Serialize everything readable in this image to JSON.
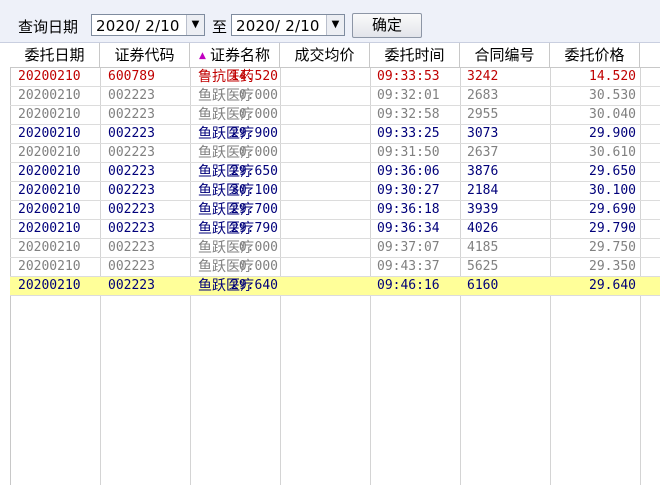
{
  "toolbar": {
    "query_label": "查询日期",
    "start_date": "2020/ 2/10",
    "to_label": "至",
    "end_date": "2020/ 2/10",
    "confirm_label": "确定",
    "dropdown_glyph": "▼"
  },
  "colors": {
    "red": "#c00000",
    "blue": "#00007a",
    "gray": "#808080",
    "highlight_bg": "#ffff99"
  },
  "table": {
    "columns": [
      "委托日期",
      "证券代码",
      "证券名称",
      "成交均价",
      "委托时间",
      "合同编号",
      "委托价格"
    ],
    "sort_indicator": "▲",
    "rows": [
      {
        "date": "20200210",
        "code": "600789",
        "name": "鲁抗医药",
        "avg_price": "14.520",
        "time": "09:33:53",
        "contract": "3242",
        "price": "14.520",
        "color": "red",
        "highlight": false
      },
      {
        "date": "20200210",
        "code": "002223",
        "name": "鱼跃医疗",
        "avg_price": "0.000",
        "time": "09:32:01",
        "contract": "2683",
        "price": "30.530",
        "color": "gray",
        "highlight": false
      },
      {
        "date": "20200210",
        "code": "002223",
        "name": "鱼跃医疗",
        "avg_price": "0.000",
        "time": "09:32:58",
        "contract": "2955",
        "price": "30.040",
        "color": "gray",
        "highlight": false
      },
      {
        "date": "20200210",
        "code": "002223",
        "name": "鱼跃医疗",
        "avg_price": "29.900",
        "time": "09:33:25",
        "contract": "3073",
        "price": "29.900",
        "color": "blue",
        "highlight": false
      },
      {
        "date": "20200210",
        "code": "002223",
        "name": "鱼跃医疗",
        "avg_price": "0.000",
        "time": "09:31:50",
        "contract": "2637",
        "price": "30.610",
        "color": "gray",
        "highlight": false
      },
      {
        "date": "20200210",
        "code": "002223",
        "name": "鱼跃医疗",
        "avg_price": "29.650",
        "time": "09:36:06",
        "contract": "3876",
        "price": "29.650",
        "color": "blue",
        "highlight": false
      },
      {
        "date": "20200210",
        "code": "002223",
        "name": "鱼跃医疗",
        "avg_price": "30.100",
        "time": "09:30:27",
        "contract": "2184",
        "price": "30.100",
        "color": "blue",
        "highlight": false
      },
      {
        "date": "20200210",
        "code": "002223",
        "name": "鱼跃医疗",
        "avg_price": "29.700",
        "time": "09:36:18",
        "contract": "3939",
        "price": "29.690",
        "color": "blue",
        "highlight": false
      },
      {
        "date": "20200210",
        "code": "002223",
        "name": "鱼跃医疗",
        "avg_price": "29.790",
        "time": "09:36:34",
        "contract": "4026",
        "price": "29.790",
        "color": "blue",
        "highlight": false
      },
      {
        "date": "20200210",
        "code": "002223",
        "name": "鱼跃医疗",
        "avg_price": "0.000",
        "time": "09:37:07",
        "contract": "4185",
        "price": "29.750",
        "color": "gray",
        "highlight": false
      },
      {
        "date": "20200210",
        "code": "002223",
        "name": "鱼跃医疗",
        "avg_price": "0.000",
        "time": "09:43:37",
        "contract": "5625",
        "price": "29.350",
        "color": "gray",
        "highlight": false
      },
      {
        "date": "20200210",
        "code": "002223",
        "name": "鱼跃医疗",
        "avg_price": "29.640",
        "time": "09:46:16",
        "contract": "6160",
        "price": "29.640",
        "color": "blue",
        "highlight": true
      }
    ]
  }
}
